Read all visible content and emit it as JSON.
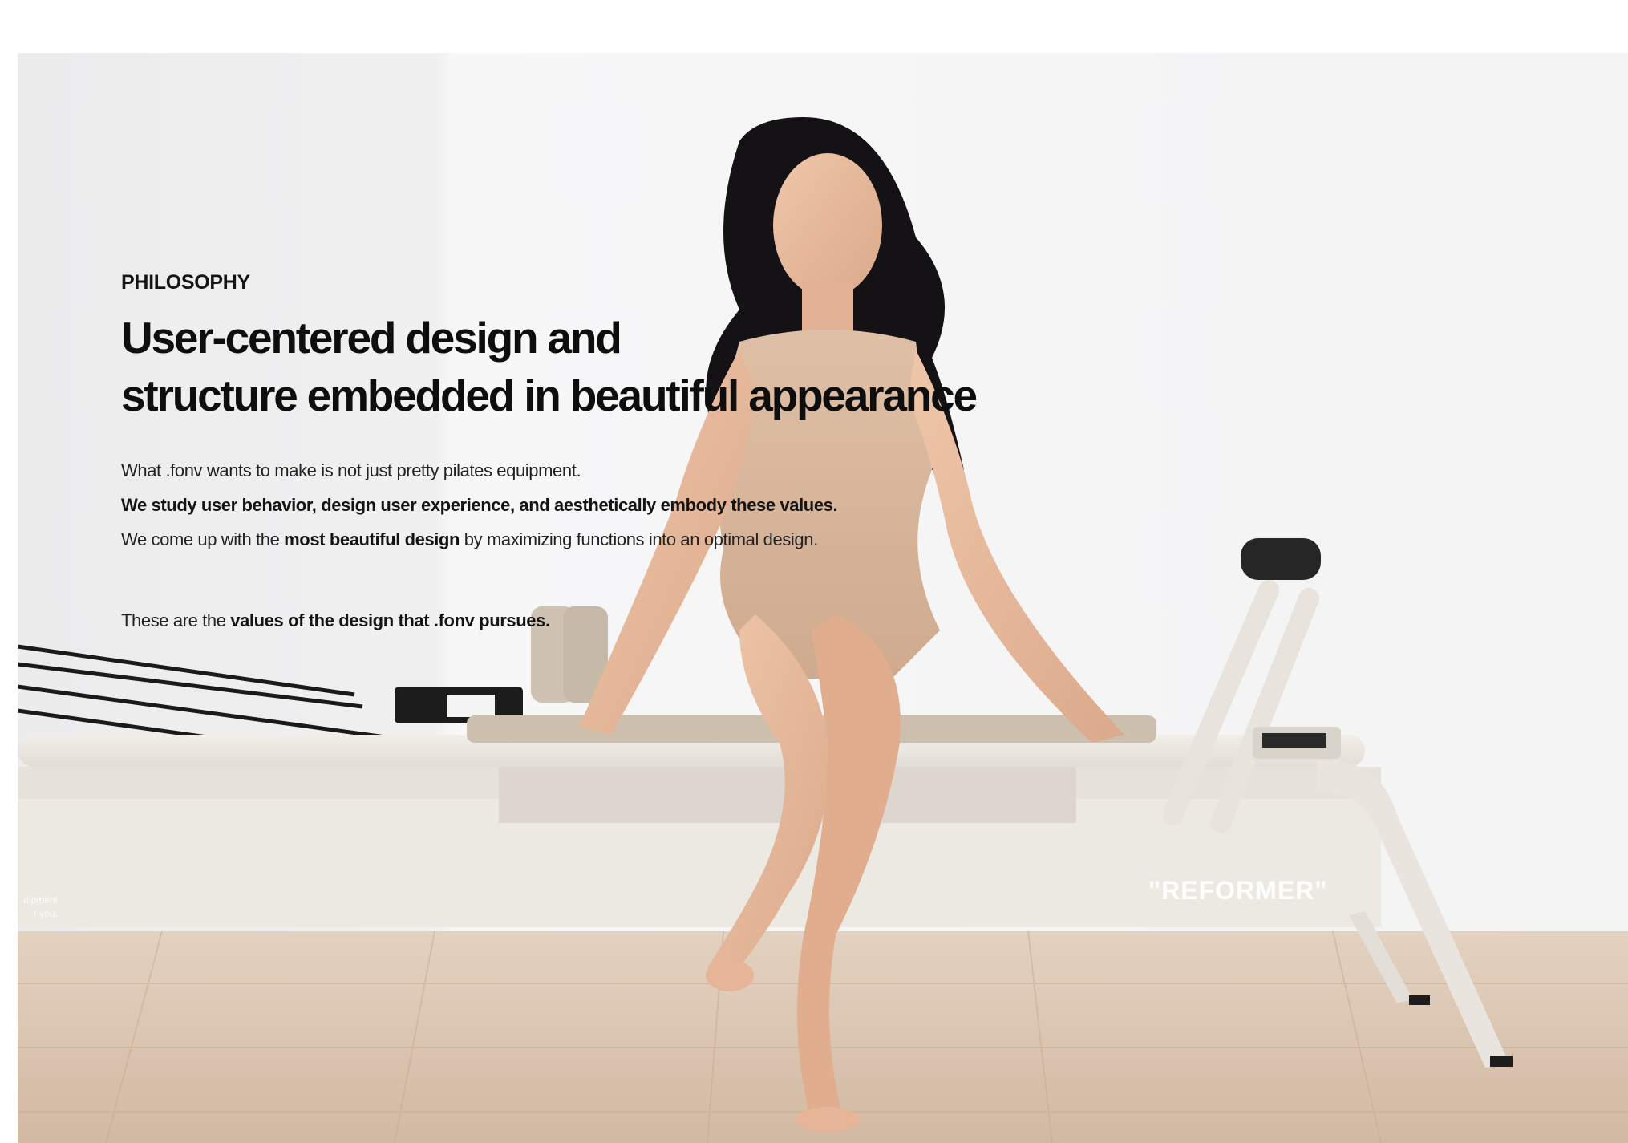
{
  "section": {
    "eyebrow": "PHILOSOPHY",
    "headline_line1": "User-centered design and",
    "headline_line2": "structure embedded in beautiful appearance",
    "body": {
      "line1": "What .fonv wants to make is not just pretty pilates equipment.",
      "line2": "We study user behavior, design user experience, and aesthetically embody these values.",
      "line3_prefix": "We come up with the ",
      "line3_bold": "most beautiful design",
      "line3_suffix": " by maximizing functions into an optimal design.",
      "line4_prefix": "These are the ",
      "line4_bold": "values of the design that .fonv pursues."
    }
  },
  "product": {
    "label": "\"REFORMER\"",
    "edge_text_line1": "uipment",
    "edge_text_line2": "r you."
  },
  "colors": {
    "wall": "#f3f3f4",
    "floor": "#d9c3ae",
    "reformer_frame": "#ebe7e0",
    "carriage": "#cdbfae",
    "skin": "#e7b99c",
    "suit": "#d9b79c",
    "hair": "#141214"
  }
}
